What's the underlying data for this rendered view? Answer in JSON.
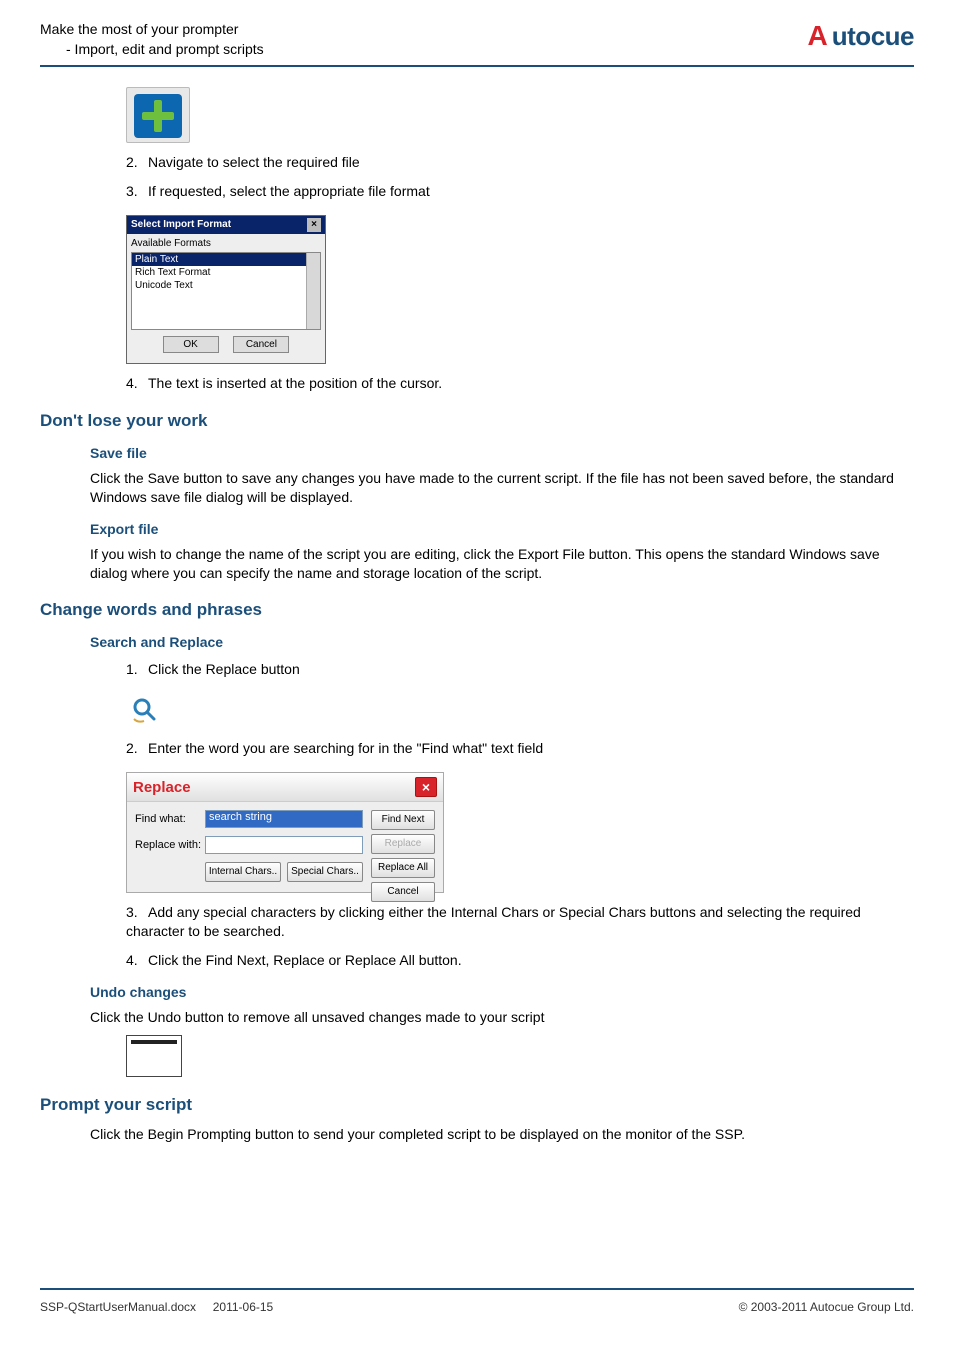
{
  "header": {
    "line1": "Make the most of your prompter",
    "line2": "- Import, edit and prompt scripts",
    "logo_prefix": "A",
    "logo_text": "utocue"
  },
  "steps_import": [
    {
      "n": "2.",
      "t": "Navigate to select the required file"
    },
    {
      "n": "3.",
      "t": "If requested, select the appropriate file format"
    }
  ],
  "import_dialog": {
    "title": "Select Import Format",
    "label": "Available Formats",
    "items": [
      "Plain Text",
      "Rich Text Format",
      "Unicode Text"
    ],
    "ok": "OK",
    "cancel": "Cancel"
  },
  "step_import_4": {
    "n": "4.",
    "t": "The text is inserted at the position of the cursor."
  },
  "sec_save": {
    "h2": "Don't lose your work",
    "save_h3": "Save file",
    "save_p": "Click the Save button to save any changes you have made to the current script. If the file has not been saved before, the standard Windows save file dialog will be displayed.",
    "export_h3": "Export file",
    "export_p": "If you wish to change the name of the script you are editing, click the Export File button. This opens the standard Windows save dialog where you can specify the name and storage location of the script."
  },
  "sec_change": {
    "h2": "Change words and phrases",
    "sr_h3": "Search and Replace",
    "step1": {
      "n": "1.",
      "t": "Click the Replace button"
    },
    "step2": {
      "n": "2.",
      "t": "Enter the word you are searching for in the \"Find what\" text field"
    },
    "step3": {
      "n": "3.",
      "t": "Add any special characters by clicking either the Internal Chars or Special Chars buttons and selecting the required character to be searched."
    },
    "step4": {
      "n": "4.",
      "t": "Click the Find Next, Replace or Replace All button."
    },
    "undo_h3": "Undo changes",
    "undo_p": "Click the Undo button to remove all unsaved changes made to your script"
  },
  "replace_dialog": {
    "title": "Replace",
    "find_label": "Find what:",
    "find_value": "search string",
    "replace_label": "Replace with:",
    "replace_value": "",
    "btn_findnext": "Find Next",
    "btn_replace": "Replace",
    "btn_replaceall": "Replace All",
    "btn_cancel": "Cancel",
    "btn_internal": "Internal Chars..",
    "btn_special": "Special Chars.."
  },
  "sec_prompt": {
    "h2": "Prompt your script",
    "p": "Click the Begin Prompting button to send your completed script to be displayed on the monitor of the SSP."
  },
  "footer": {
    "left1": "SSP-QStartUserManual.docx",
    "left2": "2011-06-15",
    "right": "© 2003-2011 Autocue Group Ltd."
  }
}
